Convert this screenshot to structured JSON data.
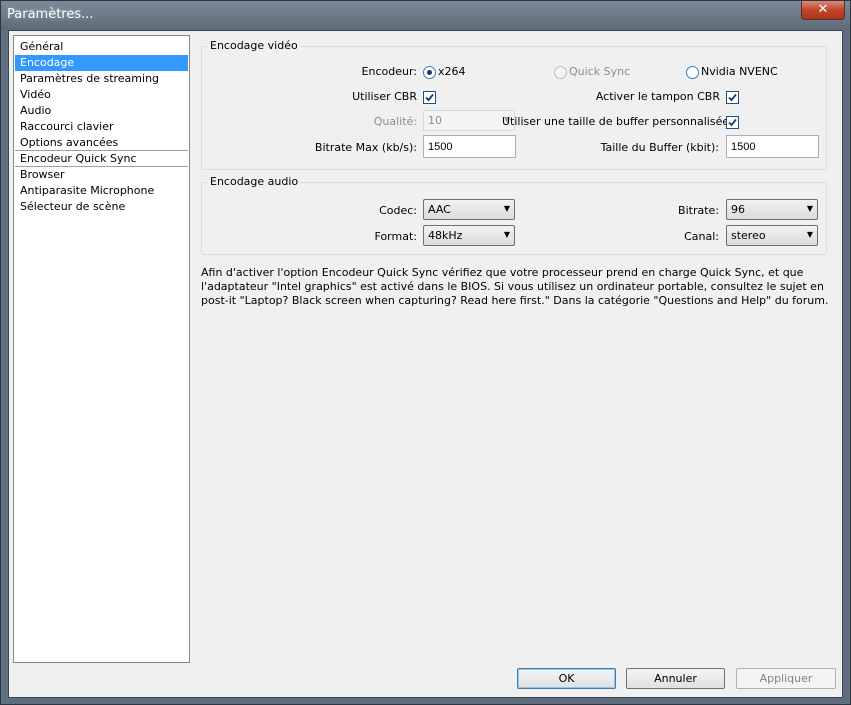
{
  "window": {
    "title": "Paramètres..."
  },
  "sidebar": {
    "items": [
      {
        "label": "Général"
      },
      {
        "label": "Encodage"
      },
      {
        "label": "Paramètres de streaming"
      },
      {
        "label": "Vidéo"
      },
      {
        "label": "Audio"
      },
      {
        "label": "Raccourci clavier"
      },
      {
        "label": "Options avancées"
      },
      {
        "label": "Encodeur Quick Sync"
      },
      {
        "label": "Browser"
      },
      {
        "label": "Antiparasite Microphone"
      },
      {
        "label": "Sélecteur de scène"
      }
    ],
    "selected_index": 1
  },
  "video": {
    "group_label": "Encodage vidéo",
    "encoder_label": "Encodeur:",
    "encoder_options": [
      {
        "label": "x264",
        "checked": true,
        "enabled": true
      },
      {
        "label": "Quick Sync",
        "checked": false,
        "enabled": false
      },
      {
        "label": "Nvidia NVENC",
        "checked": false,
        "enabled": true
      }
    ],
    "use_cbr_label": "Utiliser CBR",
    "use_cbr_checked": true,
    "buffer_padding_label": "Activer le tampon CBR",
    "buffer_padding_checked": true,
    "quality_label": "Qualité:",
    "quality_value": "10",
    "custom_buffer_label": "Utiliser une taille de buffer personnalisée",
    "custom_buffer_checked": true,
    "max_bitrate_label": "Bitrate Max (kb/s):",
    "max_bitrate_value": "1500",
    "buffer_size_label": "Taille du Buffer (kbit):",
    "buffer_size_value": "1500"
  },
  "audio": {
    "group_label": "Encodage audio",
    "codec_label": "Codec:",
    "codec_value": "AAC",
    "bitrate_label": "Bitrate:",
    "bitrate_value": "96",
    "format_label": "Format:",
    "format_value": "48kHz",
    "channel_label": "Canal:",
    "channel_value": "stereo"
  },
  "info_text": "Afin d'activer l'option Encodeur Quick Sync vérifiez que votre processeur prend en charge Quick Sync, et que l'adaptateur \"Intel graphics\" est activé dans le BIOS. Si vous utilisez un ordinateur portable, consultez le sujet  en post-it \"Laptop? Black screen when capturing? Read here first.\" Dans la catégorie \"Questions and Help\" du forum.",
  "buttons": {
    "ok": "OK",
    "cancel": "Annuler",
    "apply": "Appliquer"
  },
  "icons": {
    "close": "close-icon",
    "dropdown": "chevron-down-icon",
    "check": "check-icon"
  },
  "colors": {
    "selection": "#3399ff",
    "titlebar": "#6b7988",
    "close": "#c0442c"
  }
}
